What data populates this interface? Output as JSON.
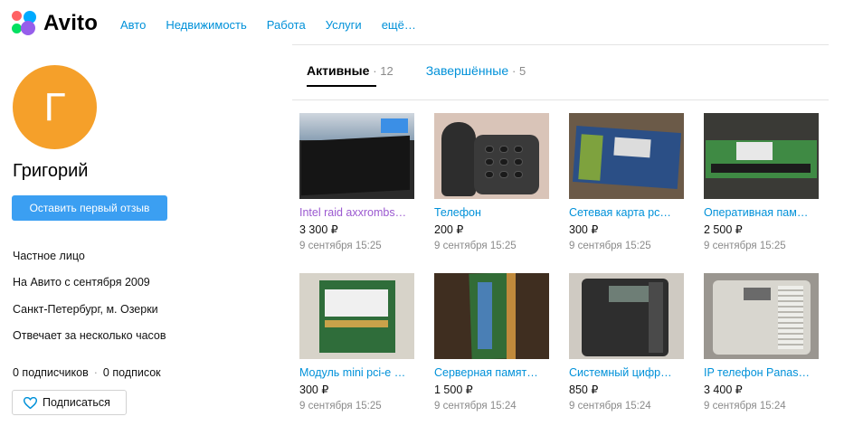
{
  "header": {
    "logo_text": "Avito",
    "nav": [
      "Авто",
      "Недвижимость",
      "Работа",
      "Услуги",
      "ещё…"
    ]
  },
  "profile": {
    "avatar_letter": "Г",
    "avatar_color": "#f5a02a",
    "name": "Григорий",
    "review_button": "Оставить первый отзыв",
    "seller_type": "Частное лицо",
    "member_since": "На Авито с сентября 2009",
    "location": "Санкт-Петербург, м. Озерки",
    "response_time": "Отвечает за несколько часов",
    "followers": "0 подписчиков",
    "following": "0 подписок",
    "follow_button": "Подписаться"
  },
  "tabs": [
    {
      "label": "Активные",
      "count": "12",
      "active": true
    },
    {
      "label": "Завершённые",
      "count": "5",
      "active": false
    }
  ],
  "listings": [
    {
      "title": "Intel raid axxrombs…",
      "price": "3 300 ₽",
      "date": "9 сентября 15:25",
      "visited": true
    },
    {
      "title": "Телефон",
      "price": "200 ₽",
      "date": "9 сентября 15:25",
      "visited": false
    },
    {
      "title": "Сетевая карта pc…",
      "price": "300 ₽",
      "date": "9 сентября 15:25",
      "visited": false
    },
    {
      "title": "Оперативная пам…",
      "price": "2 500 ₽",
      "date": "9 сентября 15:25",
      "visited": false
    },
    {
      "title": "Модуль mini pci-e …",
      "price": "300 ₽",
      "date": "9 сентября 15:25",
      "visited": false
    },
    {
      "title": "Серверная памят…",
      "price": "1 500 ₽",
      "date": "9 сентября 15:24",
      "visited": false
    },
    {
      "title": "Системный цифр…",
      "price": "850 ₽",
      "date": "9 сентября 15:24",
      "visited": false
    },
    {
      "title": "IP телефон Panas…",
      "price": "3 400 ₽",
      "date": "9 сентября 15:24",
      "visited": false
    }
  ],
  "colors": {
    "link": "#0091d9",
    "visited_link": "#9b59d0",
    "primary_button": "#3b9ff2"
  }
}
